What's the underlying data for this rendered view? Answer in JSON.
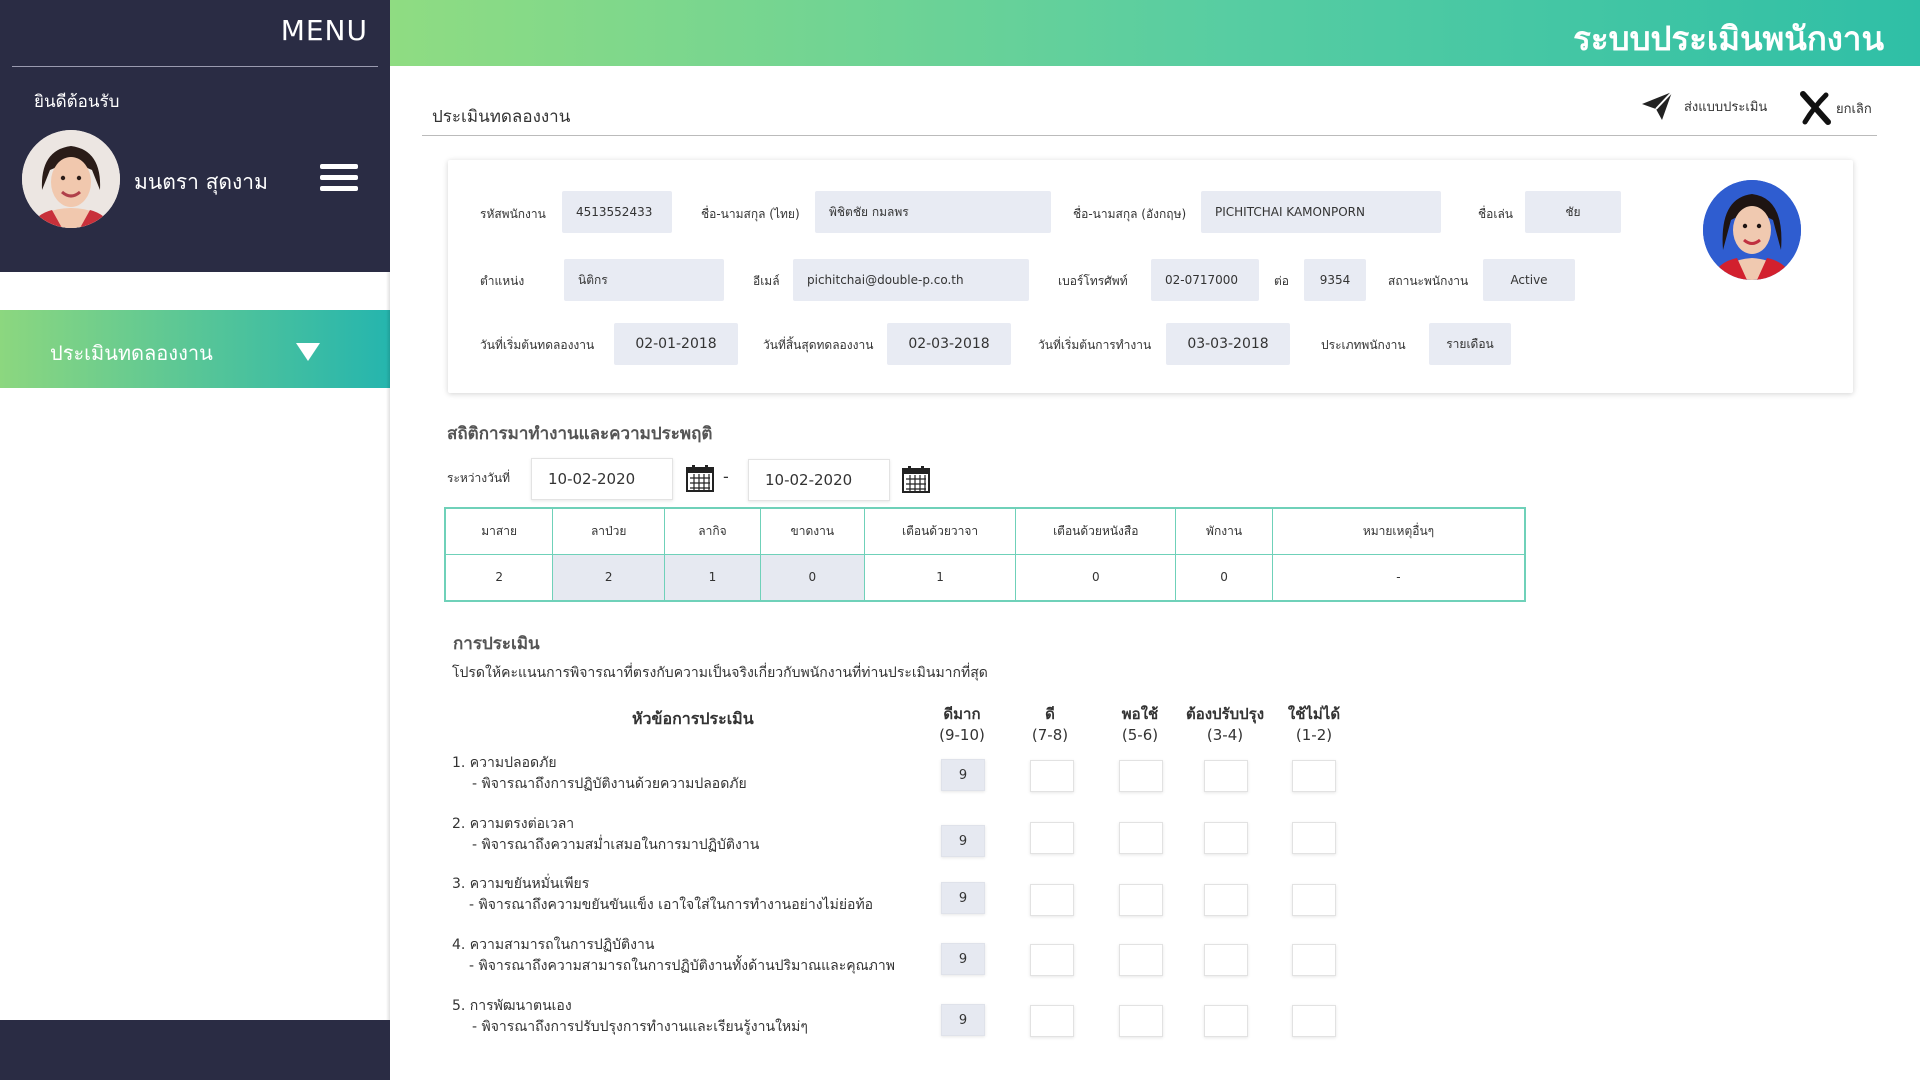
{
  "sidebar": {
    "menu_title": "MENU",
    "welcome": "ยินดีต้อนรับ",
    "user_name": "มนตรา  สุดงาม",
    "nav_item": "ประเมินทดลองงาน"
  },
  "header": {
    "app_title": "ระบบประเมินพนักงาน"
  },
  "page": {
    "title": "ประเมินทดลองงาน",
    "send_label": "ส่งแบบประเมิน",
    "cancel_label": "ยกเลิก"
  },
  "employee": {
    "emp_id_label": "รหัสพนักงาน",
    "emp_id": "4513552433",
    "name_th_label": "ชื่อ-นามสกุล (ไทย)",
    "name_th": "พิชิตชัย    กมลพร",
    "name_en_label": "ชื่อ-นามสกุล (อังกฤษ)",
    "name_en": "PICHITCHAI    KAMONPORN",
    "nickname_label": "ชื่อเล่น",
    "nickname": "ชัย",
    "position_label": "ตำแหน่ง",
    "position": "นิติกร",
    "email_label": "อีเมล์",
    "email": "pichitchai@double-p.co.th",
    "phone_label": "เบอร์โทรศัพท์",
    "phone": "02-0717000",
    "ext_label": "ต่อ",
    "ext": "9354",
    "status_label": "สถานะพนักงาน",
    "status": "Active",
    "probation_start_label": "วันที่เริ่มต้นทดลองงาน",
    "probation_start": "02-01-2018",
    "probation_end_label": "วันที่สิ้นสุดทดลองงาน",
    "probation_end": "02-03-2018",
    "work_start_label": "วันที่เริ่มต้นการทำงาน",
    "work_start": "03-03-2018",
    "emp_type_label": "ประเภทพนักงาน",
    "emp_type": "รายเดือน"
  },
  "stats": {
    "title": "สถิติการมาทำงานและความประพฤติ",
    "range_label": "ระหว่างวันที่",
    "date_from": "10-02-2020",
    "date_sep": "-",
    "date_to": "10-02-2020",
    "headers": [
      "มาสาย",
      "ลาป่วย",
      "ลากิจ",
      "ขาดงาน",
      "เตือนด้วยวาจา",
      "เตือนด้วยหนังสือ",
      "พักงาน",
      "หมายเหตุอื่นๆ"
    ],
    "values": [
      "2",
      "2",
      "1",
      "0",
      "1",
      "0",
      "0",
      "-"
    ]
  },
  "evaluation": {
    "title": "การประเมิน",
    "description": "โปรดให้คะแนนการพิจารณาที่ตรงกับความเป็นจริงเกี่ยวกับพนักงานที่ท่านประเมินมากที่สุด",
    "topic_header": "หัวข้อการประเมิน",
    "columns": [
      {
        "name": "ดีมาก",
        "range": "(9-10)"
      },
      {
        "name": "ดี",
        "range": "(7-8)"
      },
      {
        "name": "พอใช้",
        "range": "(5-6)"
      },
      {
        "name": "ต้องปรับปรุง",
        "range": "(3-4)"
      },
      {
        "name": "ใช้ไม่ได้",
        "range": "(1-2)"
      }
    ],
    "items": [
      {
        "title": "1.  ความปลอดภัย",
        "desc": "- พิจารณาถึงการปฏิบัติงานด้วยความปลอดภัย",
        "score": "9"
      },
      {
        "title": "2.  ความตรงต่อเวลา",
        "desc": "- พิจารณาถึงความสม่ำเสมอในการมาปฏิบัติงาน",
        "score": "9"
      },
      {
        "title": "3.  ความขยันหมั่นเพียร",
        "desc": "- พิจารณาถึงความขยันขันแข็ง เอาใจใส่ในการทำงานอย่างไม่ย่อท้อ",
        "score": "9"
      },
      {
        "title": "4.  ความสามารถในการปฏิบัติงาน",
        "desc": "- พิจารณาถึงความสามารถในการปฏิบัติงานทั้งด้านปริมาณและคุณภาพ",
        "score": "9"
      },
      {
        "title": "5.  การพัฒนาตนเอง",
        "desc": "- พิจารณาถึงการปรับปรุงการทำงานและเรียนรู้งานใหม่ๆ",
        "score": "9"
      }
    ]
  }
}
